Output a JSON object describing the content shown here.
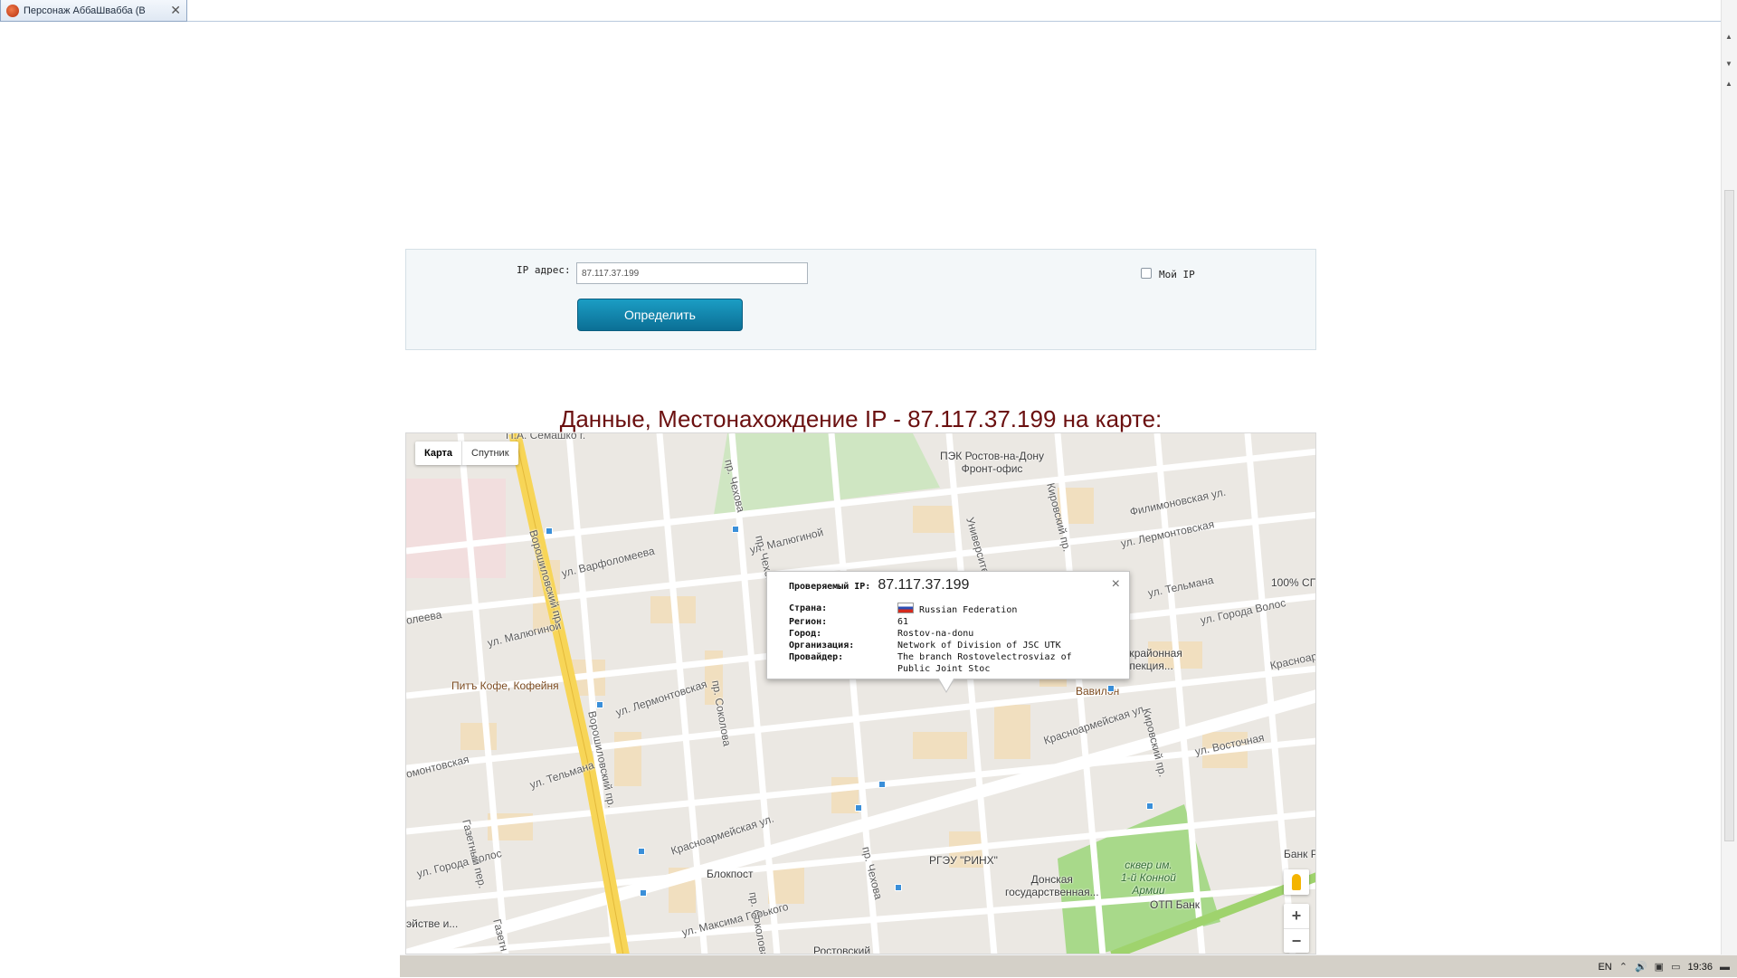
{
  "browser": {
    "tab_title": "Персонаж АббаШвабба (В",
    "tab_close": "✕"
  },
  "form": {
    "ip_label": "IP адрес:",
    "ip_value": "87.117.37.199",
    "submit_label": "Определить",
    "my_ip_label": "Мой IP"
  },
  "heading": "Данные, Местонахождение IP - 87.117.37.199 на карте:",
  "map": {
    "type_map": "Карта",
    "type_satellite": "Спутник",
    "streets": [
      "Ворошиловский пр",
      "Ворошиловский пр.",
      "ул. Варфоломеева",
      "ул. Малюгиной",
      "ул. Малюгиной",
      "ул. Лермонтовская",
      "ул. Лермонтовская",
      "ул. Тельмана",
      "ул. Тельмана",
      "пр. Соколова",
      "пр. Соколова",
      "Красноармейская ул.",
      "Красноармейская ул.",
      "пр. Чехова",
      "пр. Чехова",
      "пр. Чехова",
      "Университетский",
      "Кировский пр.",
      "Кировский пр.",
      "Филимоновская ул.",
      "ул. Города Волос",
      "ул. Города Волос",
      "ул. Восточная",
      "Газетный пер.",
      "Газетн",
      "ул. Максима Горького",
      "Красноар",
      "олеева",
      "омонтовская",
      "П.А. Семашко г."
    ],
    "pois": [
      "ПЭК Ростов-на-Дону\nФронт-офис",
      "100% СП",
      "Межрайонная\nинспекция...",
      "Вавилон",
      "Питъ Кофе, Кофейня",
      "Блокпост",
      "РГЭУ \"РИНХ\"",
      "Донская\nгосударственная...",
      "сквер им.\n1-й Конной\nАрмии",
      "ОТП Банк",
      "Банк Р",
      "эйстве и...",
      "Ростовский"
    ],
    "popup": {
      "checked_ip_label": "Проверяемый IP:",
      "checked_ip_value": "87.117.37.199",
      "close": "×",
      "rows": [
        {
          "label": "Страна:",
          "value": "Russian Federation"
        },
        {
          "label": "Регион:",
          "value": "61"
        },
        {
          "label": "Город:",
          "value": "Rostov-na-donu"
        },
        {
          "label": "Организация:",
          "value": "Network of Division of JSC UTK"
        },
        {
          "label": "Провайдер:",
          "value": "The branch Rostovelectrosviaz of Public Joint Stoc"
        }
      ]
    },
    "zoom_in": "+",
    "zoom_out": "−"
  },
  "taskbar": {
    "lang": "EN",
    "clock": "19:36"
  },
  "colors": {
    "heading": "#6b1010",
    "button": "#0f7fa8",
    "main_road": "#f7d557",
    "park": "#a8d98a"
  }
}
